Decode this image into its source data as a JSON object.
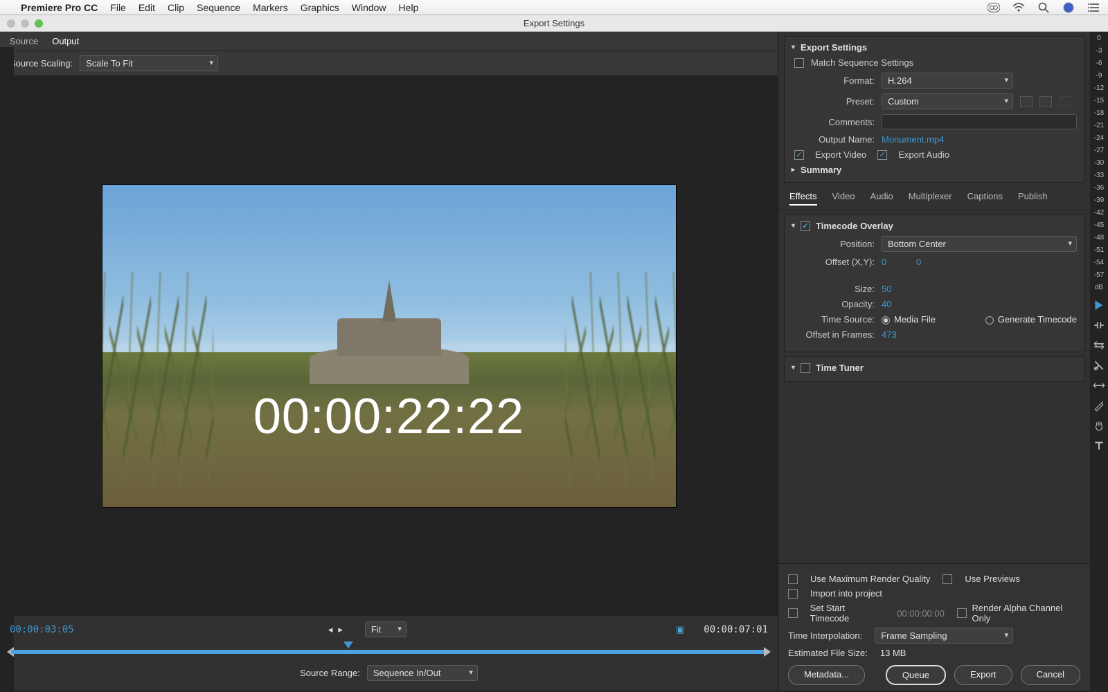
{
  "menubar": {
    "app": "Premiere Pro CC",
    "items": [
      "File",
      "Edit",
      "Clip",
      "Sequence",
      "Markers",
      "Graphics",
      "Window",
      "Help"
    ]
  },
  "window": {
    "title": "Export Settings"
  },
  "left": {
    "tabs": {
      "source": "Source",
      "output": "Output",
      "active": "Output"
    },
    "sourceScalingLabel": "Source Scaling:",
    "sourceScaling": "Scale To Fit",
    "timecodeOverlay": "00:00:22:22",
    "playbar": {
      "current": "00:00:03:05",
      "end": "00:00:07:01",
      "fit": "Fit"
    },
    "sourceRangeLabel": "Source Range:",
    "sourceRange": "Sequence In/Out"
  },
  "export": {
    "heading": "Export Settings",
    "matchSeq": "Match Sequence Settings",
    "matchSeqOn": false,
    "formatLabel": "Format:",
    "format": "H.264",
    "presetLabel": "Preset:",
    "preset": "Custom",
    "commentsLabel": "Comments:",
    "comments": "",
    "outputNameLabel": "Output Name:",
    "outputName": "Monument.mp4",
    "exportVideo": "Export Video",
    "exportVideoOn": true,
    "exportAudio": "Export Audio",
    "exportAudioOn": true,
    "summary": "Summary"
  },
  "tabs": [
    "Effects",
    "Video",
    "Audio",
    "Multiplexer",
    "Captions",
    "Publish"
  ],
  "tabActive": "Effects",
  "tcOverlay": {
    "heading": "Timecode Overlay",
    "on": true,
    "positionLabel": "Position:",
    "position": "Bottom Center",
    "offsetLabel": "Offset (X,Y):",
    "offsetX": "0",
    "offsetY": "0",
    "sizeLabel": "Size:",
    "size": "50",
    "opacityLabel": "Opacity:",
    "opacity": "40",
    "timeSourceLabel": "Time Source:",
    "mediaFile": "Media File",
    "genTC": "Generate Timecode",
    "offsetFramesLabel": "Offset in Frames:",
    "offsetFrames": "473"
  },
  "timeTuner": {
    "heading": "Time Tuner",
    "on": false
  },
  "footer": {
    "maxQuality": "Use Maximum Render Quality",
    "previews": "Use Previews",
    "import": "Import into project",
    "setStart": "Set Start Timecode",
    "startTC": "00:00:00:00",
    "alpha": "Render Alpha Channel Only",
    "interpLabel": "Time Interpolation:",
    "interp": "Frame Sampling",
    "estLabel": "Estimated File Size:",
    "est": "13 MB",
    "metadata": "Metadata...",
    "queue": "Queue",
    "export": "Export",
    "cancel": "Cancel"
  },
  "rail": [
    "0",
    "-3",
    "-6",
    "-9",
    "-12",
    "-15",
    "-18",
    "-21",
    "-24",
    "-27",
    "-30",
    "-33",
    "-36",
    "-39",
    "-42",
    "-45",
    "-48",
    "-51",
    "-54",
    "-57",
    "dB"
  ]
}
